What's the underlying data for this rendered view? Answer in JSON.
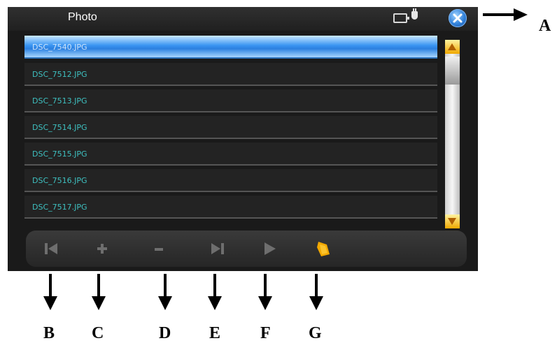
{
  "window": {
    "title": "Photo"
  },
  "icons": {
    "battery": "battery-icon",
    "plug": "power-plug-icon",
    "close": "close-icon",
    "previous": "skip-previous-icon",
    "zoom_in": "plus-icon",
    "zoom_out": "minus-icon",
    "next": "skip-next-icon",
    "play": "play-icon",
    "rotate": "rotate-icon"
  },
  "file_list": {
    "selected_index": 0,
    "items": [
      "DSC_7540.JPG",
      "DSC_7512.JPG",
      "DSC_7513.JPG",
      "DSC_7514.JPG",
      "DSC_7515.JPG",
      "DSC_7516.JPG",
      "DSC_7517.JPG"
    ]
  },
  "callouts": {
    "close": "A",
    "previous": "B",
    "zoom_in": "C",
    "zoom_out": "D",
    "next": "E",
    "play": "F",
    "rotate": "G"
  },
  "colors": {
    "selection": "#3a95f2",
    "filename_text": "#3ec0c0",
    "scroll_arrow": "#f0a800",
    "rotate_icon": "#f2a800"
  }
}
